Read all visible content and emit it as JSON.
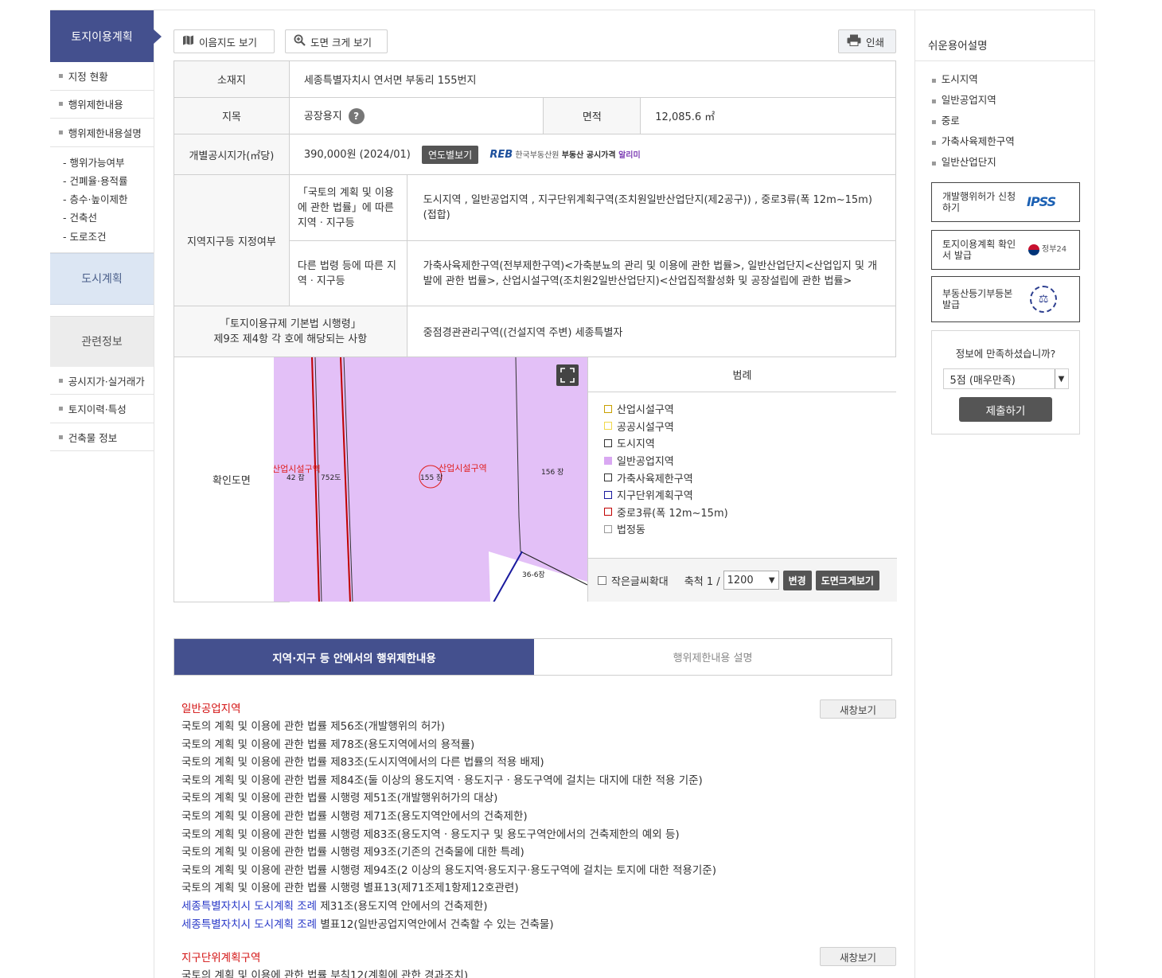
{
  "sidebar": {
    "header": "토지이용계획",
    "items": [
      "지정 현황",
      "행위제한내용",
      "행위제한내용설명"
    ],
    "sub_items": [
      "- 행위가능여부",
      "- 건폐율·용적률",
      "- 층수·높이제한",
      "- 건축선",
      "- 도로조건"
    ],
    "city_plan": "도시계획",
    "related": "관련정보",
    "related_items": [
      "공시지가·실거래가",
      "토지이력·특성",
      "건축물 정보"
    ]
  },
  "toolbar": {
    "map_label": "이음지도 보기",
    "enlarge_label": "도면 크게 보기",
    "print_label": "인쇄"
  },
  "info": {
    "address_label": "소재지",
    "address_value": "세종특별자치시 연서면 부동리 155번지",
    "jimok_label": "지목",
    "jimok_value": "공장용지",
    "help_glyph": "?",
    "area_label": "면적",
    "area_value": "12,085.6 ㎡",
    "price_label": "개별공시지가(㎡당)",
    "price_value": "390,000원 (2024/01)",
    "yearly_button": "연도별보기",
    "reb_logo": "REB",
    "reb_name": "한국부동산원",
    "reb_pub": "부동산 공시가격",
    "reb_pub_accent": "알리미",
    "zone_label": "지역지구등 지정여부",
    "zone_sub1_label": "「국토의 계획 및 이용에 관한 법률」에 따른 지역ㆍ지구등",
    "zone_sub1_value": "도시지역 , 일반공업지역 , 지구단위계획구역(조치원일반산업단지(제2공구)) , 중로3류(폭 12m~15m)(접합)",
    "zone_sub2_label": "다른 법령 등에 따른 지역ㆍ지구등",
    "zone_sub2_value": "가축사육제한구역(전부제한구역)<가축분뇨의 관리 및 이용에 관한 법률>, 일반산업단지<산업입지 및 개발에 관한 법률>, 산업시설구역(조치원2일반산업단지)<산업집적활성화 및 공장설립에 관한 법률>",
    "reg_label_1": "「토지이용규제 기본법 시행령」",
    "reg_label_2": "제9조 제4항 각 호에 해당되는 사항",
    "reg_value": "중점경관관리구역((건설지역 주변) 세종특별자",
    "map_label": "확인도면"
  },
  "map": {
    "labels": [
      "산업시설구역",
      "42 잡",
      "752도",
      "155 장",
      "산업시설구역",
      "156 장",
      "36-6장"
    ]
  },
  "legend": {
    "title": "범례",
    "items": [
      {
        "label": "산업시설구역",
        "fill": "#ffffff",
        "border": "#c8a000"
      },
      {
        "label": "공공시설구역",
        "fill": "#ffffff",
        "border": "#f0d84a"
      },
      {
        "label": "도시지역",
        "fill": "#ffffff",
        "border": "#333333"
      },
      {
        "label": "일반공업지역",
        "fill": "#d9a8f2",
        "border": "#d9a8f2"
      },
      {
        "label": "가축사육제한구역",
        "fill": "#ffffff",
        "border": "#333333"
      },
      {
        "label": "지구단위계획구역",
        "fill": "#ffffff",
        "border": "#1a1a9e"
      },
      {
        "label": "중로3류(폭 12m~15m)",
        "fill": "#ffffff",
        "border": "#c00000"
      },
      {
        "label": "법정동",
        "fill": "#ffffff",
        "border": "#999999"
      }
    ],
    "small_text": "작은글씨확대",
    "scale_prefix": "축척 1 /",
    "scale_value": "1200",
    "change_button": "변경",
    "enlarge_button": "도면크게보기"
  },
  "tabs": {
    "active": "지역·지구 등 안에서의 행위제한내용",
    "inactive": "행위제한내용 설명"
  },
  "regs": {
    "new_window": "새창보기",
    "section1_title": "일반공업지역",
    "section1_lines": [
      "국토의 계획 및 이용에 관한 법률 제56조(개발행위의 허가)",
      "국토의 계획 및 이용에 관한 법률 제78조(용도지역에서의 용적률)",
      "국토의 계획 및 이용에 관한 법률 제83조(도시지역에서의 다른 법률의 적용 배제)",
      "국토의 계획 및 이용에 관한 법률 제84조(둘 이상의 용도지역ㆍ용도지구ㆍ용도구역에 걸치는 대지에 대한 적용 기준)",
      "국토의 계획 및 이용에 관한 법률 시행령 제51조(개발행위허가의 대상)",
      "국토의 계획 및 이용에 관한 법률 시행령 제71조(용도지역안에서의 건축제한)",
      "국토의 계획 및 이용에 관한 법률 시행령 제83조(용도지역ㆍ용도지구 및 용도구역안에서의 건축제한의 예외 등)",
      "국토의 계획 및 이용에 관한 법률 시행령 제93조(기존의 건축물에 대한 특례)",
      "국토의 계획 및 이용에 관한 법률 시행령 제94조(2 이상의 용도지역·용도지구·용도구역에 걸치는 토지에 대한 적용기준)",
      "국토의 계획 및 이용에 관한 법률 시행령 별표13(제71조제1항제12호관련)"
    ],
    "ord_link_1": "세종특별자치시 도시계획 조례",
    "ord_text_1": " 제31조(용도지역 안에서의 건축제한)",
    "ord_link_2": "세종특별자치시 도시계획 조례",
    "ord_text_2": " 별표12(일반공업지역안에서 건축할 수 있는 건축물)",
    "section2_title": "지구단위계획구역",
    "section2_line": "국토의 계획 및 이용에 관한 법률 부칙12(계획에 관한 경과조치)"
  },
  "right": {
    "title": "쉬운용어설명",
    "terms": [
      "도시지역",
      "일반공업지역",
      "중로",
      "가축사육제한구역",
      "일반산업단지"
    ],
    "card1": "개발행위허가 신청하기",
    "card1_logo": "IPSS",
    "card2": "토지이용계획 확인서 발급",
    "card2_logo": "정부24",
    "card3": "부동산등기부등본 발급",
    "survey_q": "정보에 만족하셨습니까?",
    "survey_value": "5점 (매우만족)",
    "survey_submit": "제출하기"
  }
}
